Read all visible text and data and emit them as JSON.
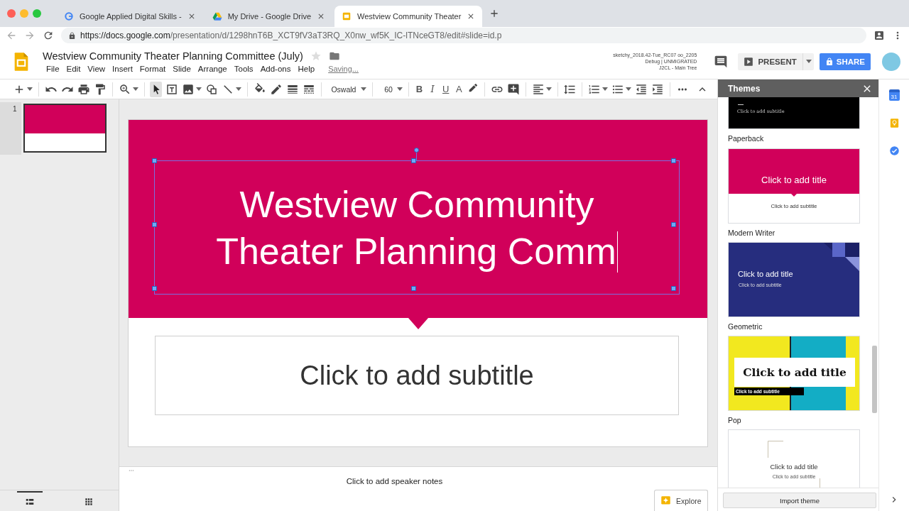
{
  "browser": {
    "tabs": [
      {
        "title": "Google Applied Digital Skills -",
        "kind": "google",
        "selected": false
      },
      {
        "title": "My Drive - Google Drive",
        "kind": "drive",
        "selected": false
      },
      {
        "title": "Westview Community Theater",
        "kind": "slides",
        "selected": true
      }
    ],
    "url_host": "https://docs.google.com",
    "url_path": "/presentation/d/1298hnT6B_XCT9fV3aT3RQ_X0nw_wf5K_IC-lTNceGT8/edit#slide=id.p"
  },
  "document": {
    "title": "Westview Community Theater Planning Committee (July)",
    "starred": false,
    "menu": [
      "File",
      "Edit",
      "View",
      "Insert",
      "Format",
      "Slide",
      "Arrange",
      "Tools",
      "Add-ons",
      "Help"
    ],
    "save_status": "Saving...",
    "build_info": [
      "sketchy_2018.42-Tue_RC07 oo_2205",
      "Debug | UNMIGRATED",
      "J2CL - Main Tree"
    ],
    "present": "PRESENT",
    "share": "SHARE"
  },
  "toolbar": {
    "pointer_active": true,
    "font": "Oswald",
    "font_size": "60",
    "format_buttons": [
      "B",
      "I",
      "U",
      "A"
    ]
  },
  "filmstrip": {
    "slides": [
      {
        "number": "1",
        "selected": true
      }
    ],
    "views": [
      {
        "kind": "list",
        "selected": true
      },
      {
        "kind": "grid",
        "selected": false
      }
    ]
  },
  "slide": {
    "title": "Westview Community Theater Planning Comm",
    "title_selected": true,
    "subtitle_placeholder": "Click to add subtitle"
  },
  "notes": {
    "placeholder": "Click to add speaker notes"
  },
  "explore": "Explore",
  "themes": {
    "title": "Themes",
    "items": [
      {
        "kind": "paperback",
        "name": "Paperback",
        "subtitle": "Click to add subtitle"
      },
      {
        "kind": "modern-writer",
        "name": "Modern Writer",
        "title": "Click to add title",
        "subtitle": "Click to add subtitle"
      },
      {
        "kind": "geometric",
        "name": "Geometric",
        "title": "Click to add title",
        "subtitle": "Click to add subtitle"
      },
      {
        "kind": "pop",
        "name": "Pop",
        "title": "Click to add title",
        "subtitle": "Click to add subtitle"
      },
      {
        "kind": "simple",
        "title": "Click to add title",
        "subtitle": "Click to add subtitle"
      }
    ],
    "import": "Import theme"
  },
  "side_rail": {
    "calendar_day": "31"
  }
}
